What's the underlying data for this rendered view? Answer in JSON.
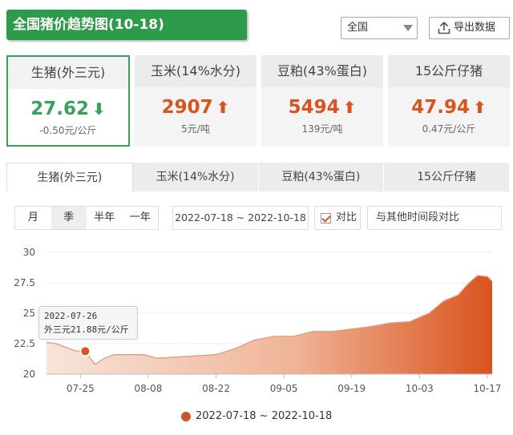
{
  "header": {
    "title": "全国猪价趋势图(10-18)",
    "region": "全国",
    "export_label": "导出数据"
  },
  "cards": [
    {
      "name": "生猪(外三元)",
      "price": "27.62",
      "direction": "down",
      "arrow": "⬇",
      "delta": "-0.50元/公斤",
      "active": true
    },
    {
      "name": "玉米(14%水分)",
      "price": "2907",
      "direction": "up",
      "arrow": "⬆",
      "delta": "5元/吨",
      "active": false
    },
    {
      "name": "豆粕(43%蛋白)",
      "price": "5494",
      "direction": "up",
      "arrow": "⬆",
      "delta": "139元/吨",
      "active": false
    },
    {
      "name": "15公斤仔猪",
      "price": "47.94",
      "direction": "up",
      "arrow": "⬆",
      "delta": "0.47元/公斤",
      "active": false
    }
  ],
  "tabs": [
    "生猪(外三元)",
    "玉米(14%水分)",
    "豆粕(43%蛋白)",
    "15公斤仔猪"
  ],
  "controls": {
    "periods": [
      "月",
      "季",
      "半年",
      "一年"
    ],
    "active_period": "季",
    "range": "2022-07-18 ~ 2022-10-18",
    "compare_label": "对比",
    "other_compare_label": "与其他时间段对比"
  },
  "tooltip": {
    "date": "2022-07-26",
    "text": "外三元21.88元/公斤"
  },
  "legend": {
    "label": "2022-07-18 ~ 2022-10-18"
  },
  "colors": {
    "accent": "#2e9b4a",
    "up": "#d9531e",
    "down": "#3aa15a",
    "series": "#c9562c"
  },
  "chart_data": {
    "type": "area",
    "x_start": "2022-07-18",
    "x_end": "2022-10-18",
    "x_tick_labels": [
      "07-25",
      "08-08",
      "08-22",
      "09-05",
      "09-19",
      "10-03",
      "10-17"
    ],
    "y_ticks": [
      20,
      22.5,
      25,
      27.5,
      30
    ],
    "ylim": [
      20,
      30
    ],
    "series": [
      {
        "name": "2022-07-18 ~ 2022-10-18",
        "points": [
          [
            "2022-07-18",
            22.6
          ],
          [
            "2022-07-20",
            22.5
          ],
          [
            "2022-07-22",
            22.2
          ],
          [
            "2022-07-24",
            21.9
          ],
          [
            "2022-07-26",
            21.88
          ],
          [
            "2022-07-28",
            20.8
          ],
          [
            "2022-07-30",
            21.3
          ],
          [
            "2022-08-01",
            21.6
          ],
          [
            "2022-08-04",
            21.6
          ],
          [
            "2022-08-07",
            21.6
          ],
          [
            "2022-08-10",
            21.3
          ],
          [
            "2022-08-14",
            21.4
          ],
          [
            "2022-08-18",
            21.5
          ],
          [
            "2022-08-22",
            21.6
          ],
          [
            "2022-08-26",
            22.1
          ],
          [
            "2022-08-30",
            22.8
          ],
          [
            "2022-09-03",
            23.1
          ],
          [
            "2022-09-07",
            23.1
          ],
          [
            "2022-09-11",
            23.5
          ],
          [
            "2022-09-15",
            23.5
          ],
          [
            "2022-09-19",
            23.7
          ],
          [
            "2022-09-23",
            23.9
          ],
          [
            "2022-09-27",
            24.2
          ],
          [
            "2022-10-01",
            24.3
          ],
          [
            "2022-10-05",
            25.0
          ],
          [
            "2022-10-08",
            26.0
          ],
          [
            "2022-10-11",
            26.5
          ],
          [
            "2022-10-13",
            27.4
          ],
          [
            "2022-10-15",
            28.1
          ],
          [
            "2022-10-17",
            28.0
          ],
          [
            "2022-10-18",
            27.62
          ]
        ]
      }
    ],
    "highlight": {
      "x": "2022-07-26",
      "y": 21.88
    }
  }
}
